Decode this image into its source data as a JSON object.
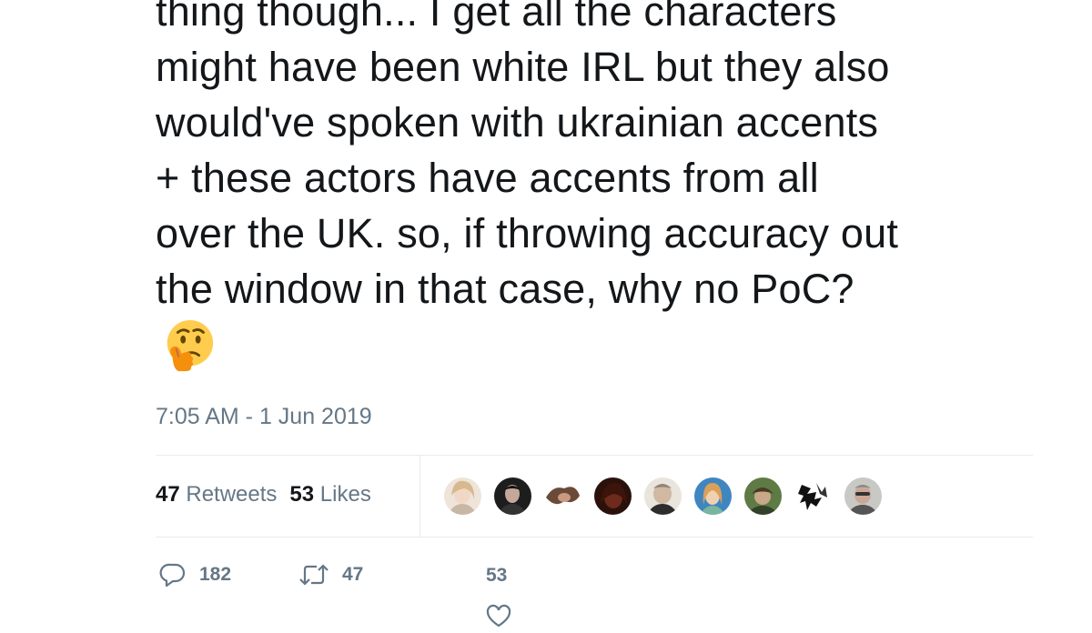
{
  "tweet": {
    "text_lines": [
      "thing though... I get all the characters",
      "might have been white IRL but they also",
      "would've spoken with ukrainian accents",
      "+ these actors have accents from all",
      "over the UK. so, if throwing accuracy out",
      "the window in that case, why no PoC?"
    ],
    "emoji": "thinking-face",
    "timestamp": "7:05 AM - 1 Jun 2019"
  },
  "stats": {
    "retweets_count": "47",
    "retweets_label": "Retweets",
    "likes_count": "53",
    "likes_label": "Likes"
  },
  "liked_by_avatars": [
    {
      "name": "avatar-1",
      "color": "#d9c3b0"
    },
    {
      "name": "avatar-2",
      "color": "#2b2b2b"
    },
    {
      "name": "avatar-3",
      "color": "#5a4032"
    },
    {
      "name": "avatar-4",
      "color": "#3a1e14"
    },
    {
      "name": "avatar-5",
      "color": "#b8ab9a"
    },
    {
      "name": "avatar-6",
      "color": "#4a86b8"
    },
    {
      "name": "avatar-7",
      "color": "#4f6b3a"
    },
    {
      "name": "avatar-8",
      "color": "#e8e8e8"
    },
    {
      "name": "avatar-9",
      "color": "#8c8c8c"
    }
  ],
  "actions": {
    "reply_count": "182",
    "retweet_count": "47",
    "like_count": "53"
  },
  "colors": {
    "text": "#14171a",
    "secondary": "#657786",
    "divider": "#e6ecf0"
  }
}
